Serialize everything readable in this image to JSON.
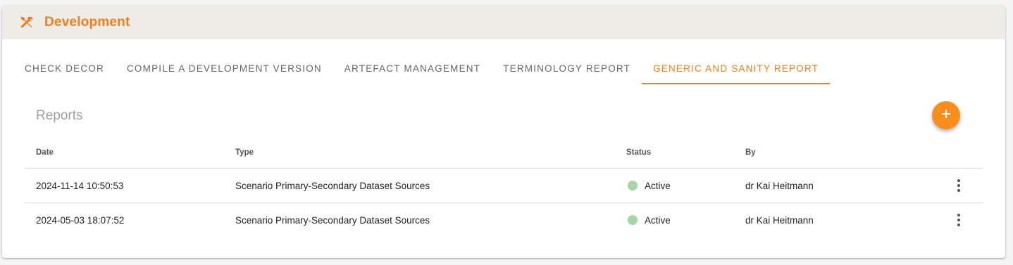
{
  "header": {
    "title": "Development",
    "icon": "tools-icon",
    "accent_color": "#f07e1b",
    "background": "#efebe6"
  },
  "tabs": [
    {
      "label": "CHECK DECOR",
      "active": false
    },
    {
      "label": "COMPILE A DEVELOPMENT VERSION",
      "active": false
    },
    {
      "label": "ARTEFACT MANAGEMENT",
      "active": false
    },
    {
      "label": "TERMINOLOGY REPORT",
      "active": false
    },
    {
      "label": "GENERIC AND SANITY REPORT",
      "active": true
    }
  ],
  "reports": {
    "title": "Reports",
    "add_button_icon": "plus-icon",
    "add_button_color": "#fb8c1e",
    "columns": {
      "date": "Date",
      "type": "Type",
      "status": "Status",
      "by": "By"
    },
    "rows": [
      {
        "date": "2024-11-14 10:50:53",
        "type": "Scenario Primary-Secondary Dataset Sources",
        "status": "Active",
        "status_color": "#a5d6a7",
        "by": "dr Kai Heitmann"
      },
      {
        "date": "2024-05-03 18:07:52",
        "type": "Scenario Primary-Secondary Dataset Sources",
        "status": "Active",
        "status_color": "#a5d6a7",
        "by": "dr Kai Heitmann"
      }
    ]
  }
}
